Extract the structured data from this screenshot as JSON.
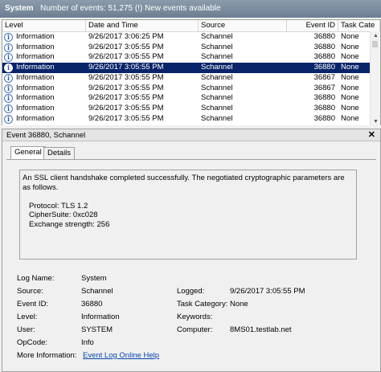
{
  "header": {
    "title": "System",
    "event_count": "Number of events: 51,275 (!) New events available"
  },
  "columns": [
    "Level",
    "Date and Time",
    "Source",
    "Event ID",
    "Task Cate"
  ],
  "rows": [
    {
      "level": "Information",
      "date": "9/26/2017 3:06:25 PM",
      "source": "Schannel",
      "event_id": "36880",
      "task": "None"
    },
    {
      "level": "Information",
      "date": "9/26/2017 3:05:55 PM",
      "source": "Schannel",
      "event_id": "36880",
      "task": "None"
    },
    {
      "level": "Information",
      "date": "9/26/2017 3:05:55 PM",
      "source": "Schannel",
      "event_id": "36880",
      "task": "None"
    },
    {
      "level": "Information",
      "date": "9/26/2017 3:05:55 PM",
      "source": "Schannel",
      "event_id": "36880",
      "task": "None",
      "selected": true
    },
    {
      "level": "Information",
      "date": "9/26/2017 3:05:55 PM",
      "source": "Schannel",
      "event_id": "36867",
      "task": "None"
    },
    {
      "level": "Information",
      "date": "9/26/2017 3:05:55 PM",
      "source": "Schannel",
      "event_id": "36867",
      "task": "None"
    },
    {
      "level": "Information",
      "date": "9/26/2017 3:05:55 PM",
      "source": "Schannel",
      "event_id": "36880",
      "task": "None"
    },
    {
      "level": "Information",
      "date": "9/26/2017 3:05:55 PM",
      "source": "Schannel",
      "event_id": "36880",
      "task": "None"
    },
    {
      "level": "Information",
      "date": "9/26/2017 3:05:55 PM",
      "source": "Schannel",
      "event_id": "36880",
      "task": "None"
    }
  ],
  "details": {
    "header_title": "Event 36880, Schannel",
    "close_glyph": "✕",
    "tabs": [
      "General",
      "Details"
    ],
    "message": {
      "line1": "An SSL client handshake completed successfully. The negotiated cryptographic parameters are as follows.",
      "protocol": "Protocol: TLS 1.2",
      "cipher": "CipherSuite: 0xc028",
      "exchange": "Exchange strength: 256"
    },
    "fields": {
      "log_name_label": "Log Name:",
      "log_name": "System",
      "source_label": "Source:",
      "source": "Schannel",
      "logged_label": "Logged:",
      "logged": "9/26/2017 3:05:55 PM",
      "event_id_label": "Event ID:",
      "event_id": "36880",
      "task_label": "Task Category:",
      "task": "None",
      "level_label": "Level:",
      "level": "Information",
      "keywords_label": "Keywords:",
      "keywords": "",
      "user_label": "User:",
      "user": "SYSTEM",
      "computer_label": "Computer:",
      "computer": "8MS01.testlab.net",
      "opcode_label": "OpCode:",
      "opcode": "Info",
      "more_info_label": "More Information:",
      "more_info_link": "Event Log Online Help"
    }
  },
  "icons": {
    "info": "information-icon"
  },
  "colors": {
    "selection": "#0a246a",
    "link": "#0645ad",
    "header_bar": "#7a8ba0"
  }
}
